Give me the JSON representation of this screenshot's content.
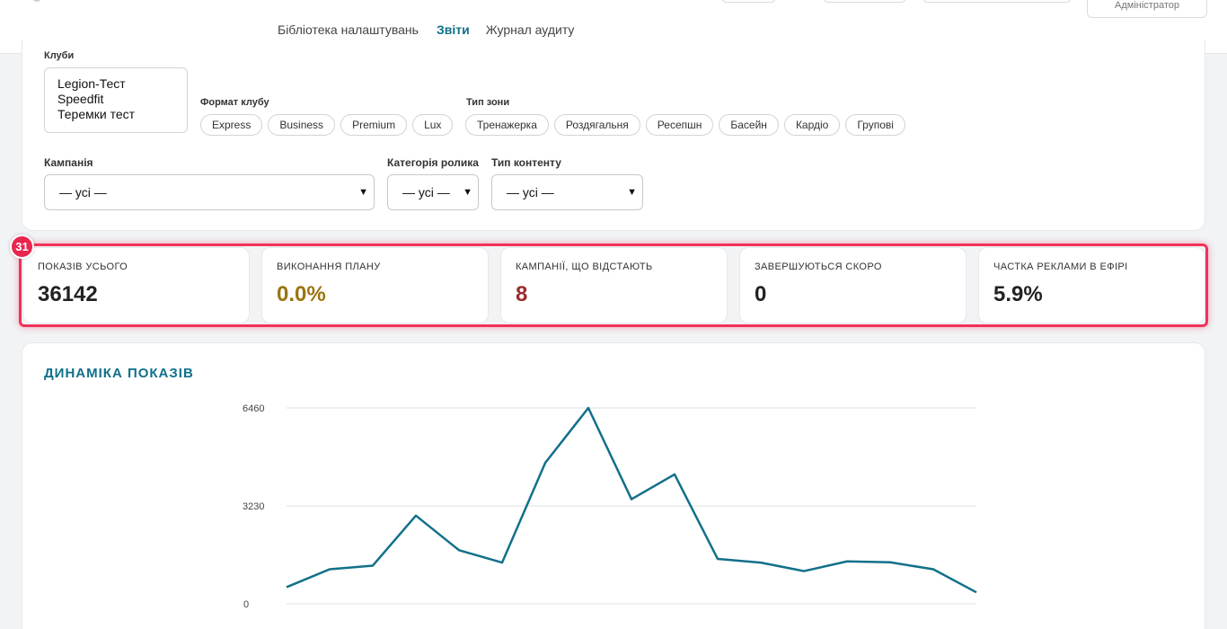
{
  "header": {
    "user_role": "Адміністратор",
    "tabs": [
      {
        "label": "Бібліотека налаштувань",
        "active": false
      },
      {
        "label": "Звіти",
        "active": true
      },
      {
        "label": "Журнал аудиту",
        "active": false
      }
    ]
  },
  "filters": {
    "clubs_label": "Клуби",
    "clubs": [
      "Legion-Тест",
      "Speedfit",
      "Теремки тест"
    ],
    "club_format_label": "Формат клубу",
    "club_formats": [
      "Express",
      "Business",
      "Premium",
      "Lux"
    ],
    "zone_type_label": "Тип зони",
    "zone_types": [
      "Тренажерка",
      "Роздягальня",
      "Ресепшн",
      "Басейн",
      "Кардіо",
      "Групові"
    ],
    "campaign_label": "Кампанія",
    "campaign_value": "— усі —",
    "clip_category_label": "Категорія ролика",
    "clip_category_value": "— усі —",
    "content_type_label": "Тип контенту",
    "content_type_value": "— усі —"
  },
  "kpi_badge": "31",
  "kpis": [
    {
      "label": "ПОКАЗІВ УСЬОГО",
      "value": "36142",
      "color": "#222222"
    },
    {
      "label": "ВИКОНАННЯ ПЛАНУ",
      "value": "0.0%",
      "color": "#9a7410"
    },
    {
      "label": "КАМПАНІЇ, ЩО ВІДСТАЮТЬ",
      "value": "8",
      "color": "#9b2c2c"
    },
    {
      "label": "ЗАВЕРШУЮТЬСЯ СКОРО",
      "value": "0",
      "color": "#222222"
    },
    {
      "label": "ЧАСТКА РЕКЛАМИ В ЕФІРІ",
      "value": "5.9%",
      "color": "#222222"
    }
  ],
  "chart": {
    "title": "ДИНАМІКА ПОКАЗІВ",
    "line_color": "#12708a"
  },
  "chart_data": {
    "type": "line",
    "title": "ДИНАМІКА ПОКАЗІВ",
    "ylim": [
      0,
      6460
    ],
    "yticks": [
      0,
      3230,
      6460
    ],
    "grid": true,
    "series": [
      {
        "values": [
          550,
          1140,
          1260,
          2910,
          1770,
          1360,
          4650,
          6460,
          3450,
          4270,
          1480,
          1360,
          1080,
          1400,
          1370,
          1140,
          380
        ]
      }
    ]
  }
}
